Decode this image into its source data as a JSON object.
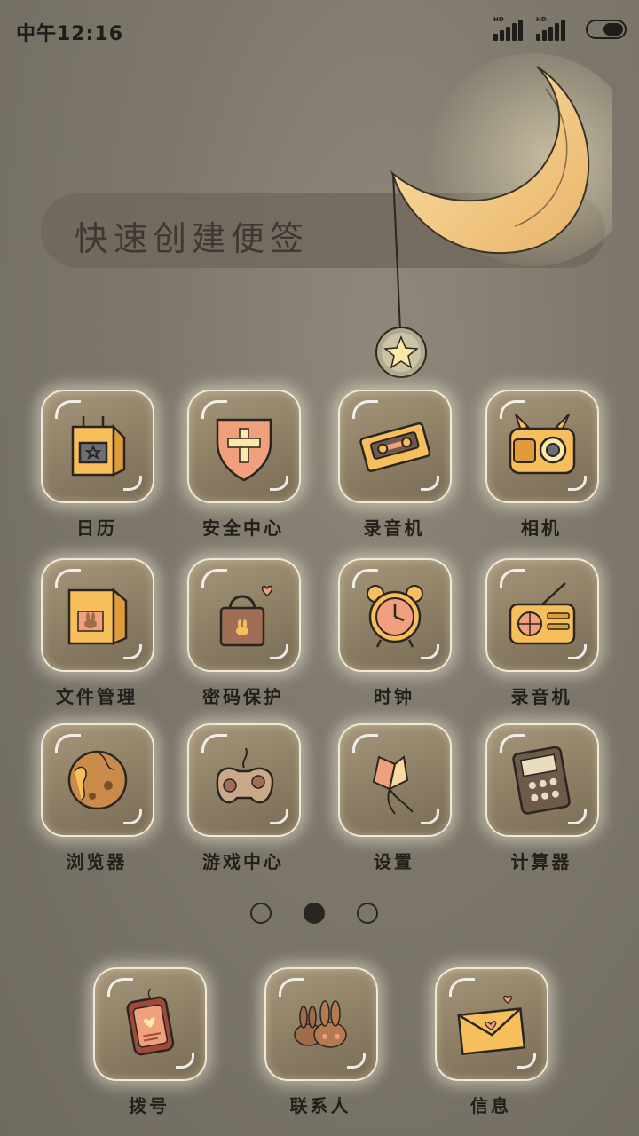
{
  "status_bar": {
    "time": "中午12:16",
    "signal1_label": "HD",
    "signal2_label": "HD"
  },
  "note_widget": {
    "text": "快速创建便签"
  },
  "apps": [
    {
      "label": "日历",
      "icon": "calendar-bag-icon"
    },
    {
      "label": "安全中心",
      "icon": "shield-icon"
    },
    {
      "label": "录音机",
      "icon": "cassette-icon"
    },
    {
      "label": "相机",
      "icon": "camera-icon"
    },
    {
      "label": "文件管理",
      "icon": "paper-bag-icon"
    },
    {
      "label": "密码保护",
      "icon": "lock-bag-icon"
    },
    {
      "label": "时钟",
      "icon": "alarm-clock-icon"
    },
    {
      "label": "录音机",
      "icon": "radio-icon"
    },
    {
      "label": "浏览器",
      "icon": "cookie-icon"
    },
    {
      "label": "游戏中心",
      "icon": "gamepad-icon"
    },
    {
      "label": "设置",
      "icon": "candy-icon"
    },
    {
      "label": "计算器",
      "icon": "calculator-icon"
    }
  ],
  "page_indicator": {
    "count": 3,
    "active_index": 1
  },
  "dock": [
    {
      "label": "拨号",
      "icon": "phone-icon"
    },
    {
      "label": "联系人",
      "icon": "bunnies-icon"
    },
    {
      "label": "信息",
      "icon": "envelope-icon"
    }
  ],
  "colors": {
    "background": "#7d776b",
    "tile": "#8c7e64",
    "icon_accent": "#f0b860",
    "text": "#221f1b"
  }
}
